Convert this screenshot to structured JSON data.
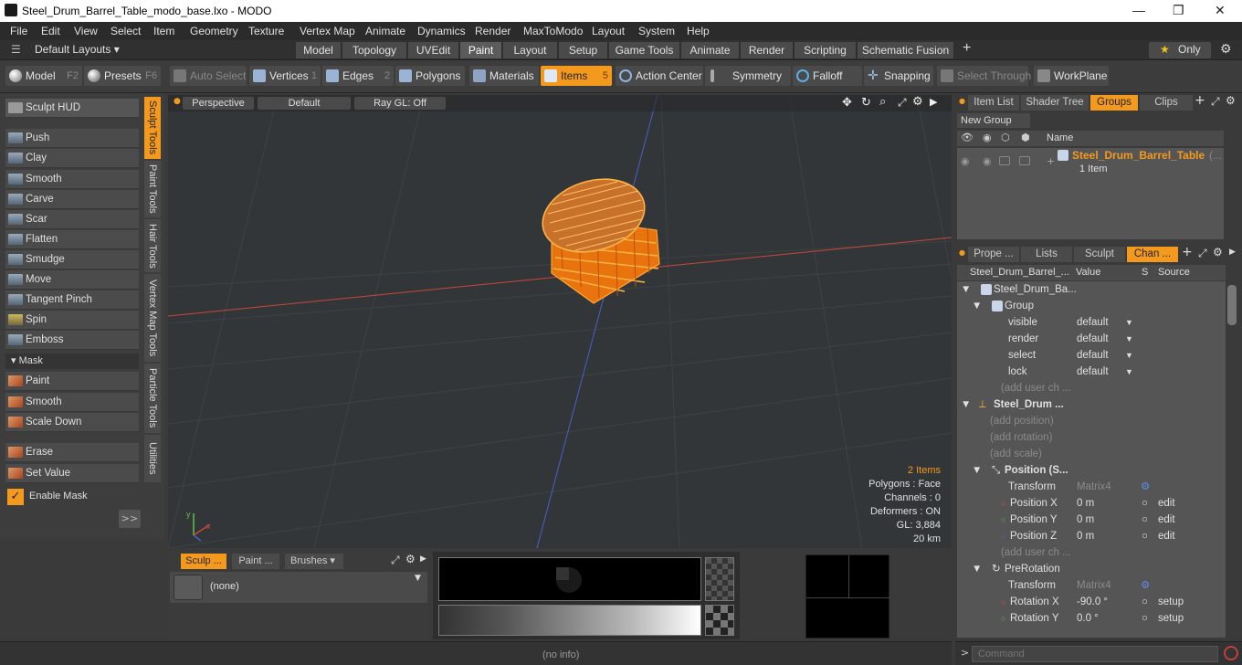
{
  "window": {
    "title": "Steel_Drum_Barrel_Table_modo_base.lxo - MODO",
    "minimize": "—",
    "maximize": "❐",
    "close": "✕"
  },
  "menu": [
    "File",
    "Edit",
    "View",
    "Select",
    "Item",
    "Geometry",
    "Texture",
    "Vertex Map",
    "Animate",
    "Dynamics",
    "Render",
    "MaxToModo",
    "Layout",
    "System",
    "Help"
  ],
  "layouts": {
    "label": "Default Layouts ▾",
    "tabs": [
      "Model",
      "Topology",
      "UVEdit",
      "Paint",
      "Layout",
      "Setup",
      "Game Tools",
      "Animate",
      "Render",
      "Scripting",
      "Schematic Fusion"
    ],
    "active": "Paint",
    "add": "+",
    "only": "Only",
    "star": "★",
    "gear": "⚙"
  },
  "toolbar": {
    "model": "Model",
    "model_key": "F2",
    "presets": "Presets",
    "presets_key": "F6",
    "auto_select": "Auto Select",
    "vertices": "Vertices",
    "vertices_key": "1",
    "edges": "Edges",
    "edges_key": "2",
    "polygons": "Polygons",
    "materials": "Materials",
    "items": "Items",
    "items_key": "5",
    "action_center": "Action Center",
    "symmetry": "Symmetry",
    "falloff": "Falloff",
    "snapping": "Snapping",
    "select_through": "Select Through",
    "workplane": "WorkPlane"
  },
  "left": {
    "sculpt_hud": "Sculpt HUD",
    "tools": [
      "Push",
      "Clay",
      "Smooth",
      "Carve",
      "Scar",
      "Flatten",
      "Smudge",
      "Move",
      "Tangent Pinch",
      "Spin",
      "Emboss"
    ],
    "mask_header": "Mask",
    "mask_tools": [
      "Paint",
      "Smooth",
      "Scale Down"
    ],
    "erase": "Erase",
    "set_value": "Set Value",
    "enable_mask": "Enable Mask",
    "expand": ">>",
    "vtabs": [
      "Sculpt Tools",
      "Paint Tools",
      "Hair Tools",
      "Vertex Map Tools",
      "Particle Tools",
      "Utilities"
    ]
  },
  "viewport": {
    "perspective": "Perspective",
    "default": "Default",
    "raygl": "Ray GL: Off",
    "stats": {
      "items": "2 Items",
      "polygons": "Polygons : Face",
      "channels": "Channels : 0",
      "deformers": "Deformers : ON",
      "gl": "GL: 3,884",
      "scale": "20 km"
    }
  },
  "bottom": {
    "tabs": [
      "Sculp ...",
      "Paint ...",
      "Brushes"
    ],
    "none": "(none)",
    "status": "(no info)"
  },
  "rightTop": {
    "tabs": [
      "Item List",
      "Shader Tree",
      "Groups",
      "Clips"
    ],
    "active": "Groups",
    "new_group": "New Group",
    "name_header": "Name",
    "group_name": "Steel_Drum_Barrel_Table",
    "group_suffix": "(...",
    "group_count": "1 Item"
  },
  "rightBottom": {
    "tabs": [
      "Prope ...",
      "Lists",
      "Sculpt",
      "Chan ..."
    ],
    "active": "Chan ...",
    "headers": [
      "Steel_Drum_Barrel_...",
      "Value",
      "S",
      "Source"
    ],
    "rows": [
      {
        "name": "Steel_Drum_Ba...",
        "value": "",
        "src": "",
        "indent": 0
      },
      {
        "name": "Group",
        "value": "",
        "src": "",
        "indent": 1
      },
      {
        "name": "visible",
        "value": "default",
        "src": "",
        "indent": 2
      },
      {
        "name": "render",
        "value": "default",
        "src": "",
        "indent": 2
      },
      {
        "name": "select",
        "value": "default",
        "src": "",
        "indent": 2
      },
      {
        "name": "lock",
        "value": "default",
        "src": "",
        "indent": 2
      },
      {
        "name": "(add user ch ...",
        "value": "",
        "src": "",
        "indent": 2
      },
      {
        "name": "Steel_Drum ...",
        "value": "",
        "src": "",
        "indent": 0
      },
      {
        "name": "(add position)",
        "value": "",
        "src": "",
        "indent": 1
      },
      {
        "name": "(add rotation)",
        "value": "",
        "src": "",
        "indent": 1
      },
      {
        "name": "(add scale)",
        "value": "",
        "src": "",
        "indent": 1
      },
      {
        "name": "Position (S...",
        "value": "",
        "src": "",
        "indent": 1
      },
      {
        "name": "Transform",
        "value": "Matrix4",
        "src": "",
        "indent": 2
      },
      {
        "name": "Position X",
        "value": "0 m",
        "src": "edit",
        "indent": 2
      },
      {
        "name": "Position Y",
        "value": "0 m",
        "src": "edit",
        "indent": 2
      },
      {
        "name": "Position Z",
        "value": "0 m",
        "src": "edit",
        "indent": 2
      },
      {
        "name": "(add user ch ...",
        "value": "",
        "src": "",
        "indent": 2
      },
      {
        "name": "PreRotation",
        "value": "",
        "src": "",
        "indent": 1
      },
      {
        "name": "Transform",
        "value": "Matrix4",
        "src": "",
        "indent": 2
      },
      {
        "name": "Rotation X",
        "value": "-90.0 °",
        "src": "setup",
        "indent": 2
      },
      {
        "name": "Rotation Y",
        "value": "0.0 °",
        "src": "setup",
        "indent": 2
      }
    ]
  },
  "command": {
    "placeholder": "Command",
    "prompt": ">"
  },
  "colors": {
    "accent": "#f39a1e",
    "axis_red": "#c8493a",
    "axis_blue": "#4a60c8",
    "object": "#ff7a00"
  }
}
